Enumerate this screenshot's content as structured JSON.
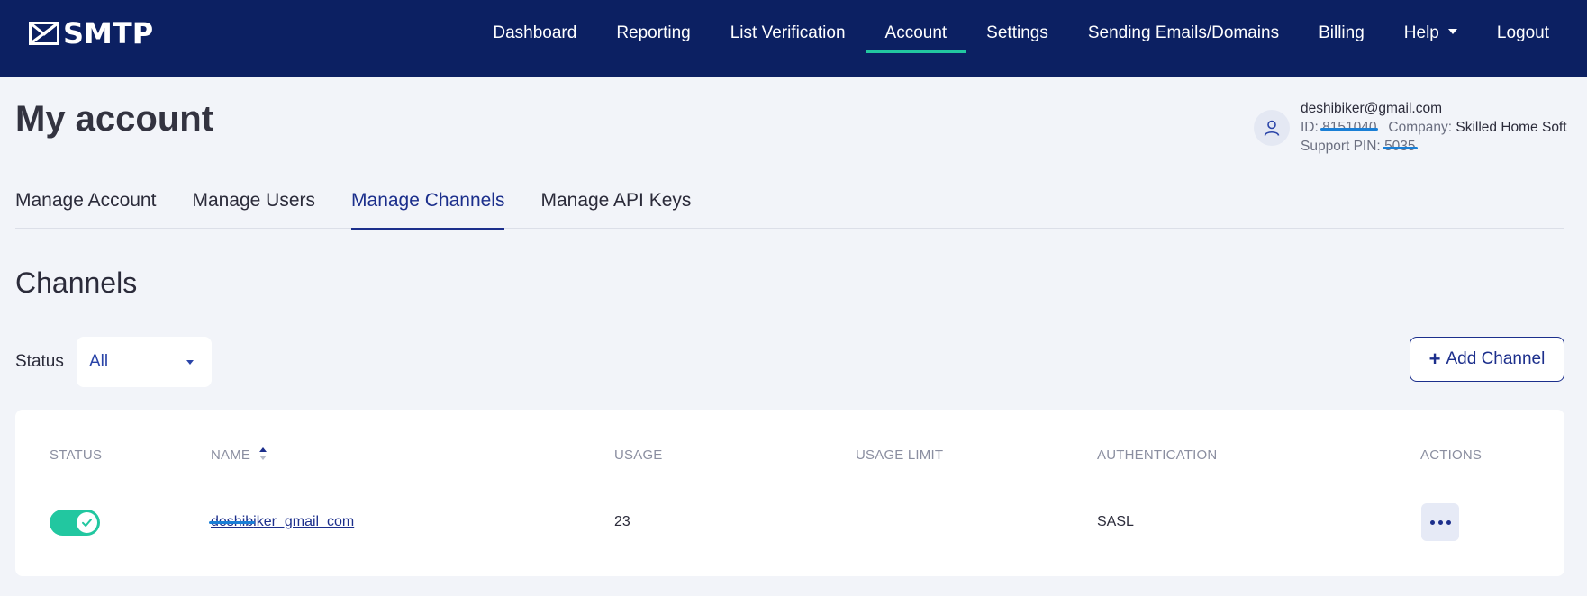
{
  "brand": {
    "logo_text": "SMTP"
  },
  "nav": {
    "items": [
      {
        "label": "Dashboard"
      },
      {
        "label": "Reporting"
      },
      {
        "label": "List Verification"
      },
      {
        "label": "Account",
        "active": true
      },
      {
        "label": "Settings"
      },
      {
        "label": "Sending Emails/Domains"
      },
      {
        "label": "Billing"
      },
      {
        "label": "Help"
      },
      {
        "label": "Logout"
      }
    ]
  },
  "page": {
    "title": "My account"
  },
  "account": {
    "email": "deshibiker@gmail.com",
    "id_label": "ID:",
    "id_value": "8151040",
    "company_label": "Company:",
    "company_value": "Skilled Home Soft",
    "pin_label": "Support PIN:",
    "pin_value": "5035",
    "icon": "user-icon"
  },
  "tabs": [
    {
      "label": "Manage Account"
    },
    {
      "label": "Manage Users"
    },
    {
      "label": "Manage Channels",
      "active": true
    },
    {
      "label": "Manage API Keys"
    }
  ],
  "channels": {
    "title": "Channels",
    "filter": {
      "label": "Status",
      "selected": "All"
    },
    "add_button": "Add Channel",
    "columns": {
      "status": "STATUS",
      "name": "NAME",
      "usage": "USAGE",
      "usage_limit": "USAGE LIMIT",
      "authentication": "AUTHENTICATION",
      "actions": "ACTIONS"
    },
    "rows": [
      {
        "enabled": true,
        "name_hidden": "deshib",
        "name_visible": "iker_gmail_com",
        "usage": "23",
        "usage_limit": "",
        "authentication": "SASL"
      }
    ]
  },
  "colors": {
    "nav_bg": "#0c2062",
    "accent": "#22c7a0",
    "primary": "#1c2f8c",
    "page_bg": "#f2f4f9"
  }
}
